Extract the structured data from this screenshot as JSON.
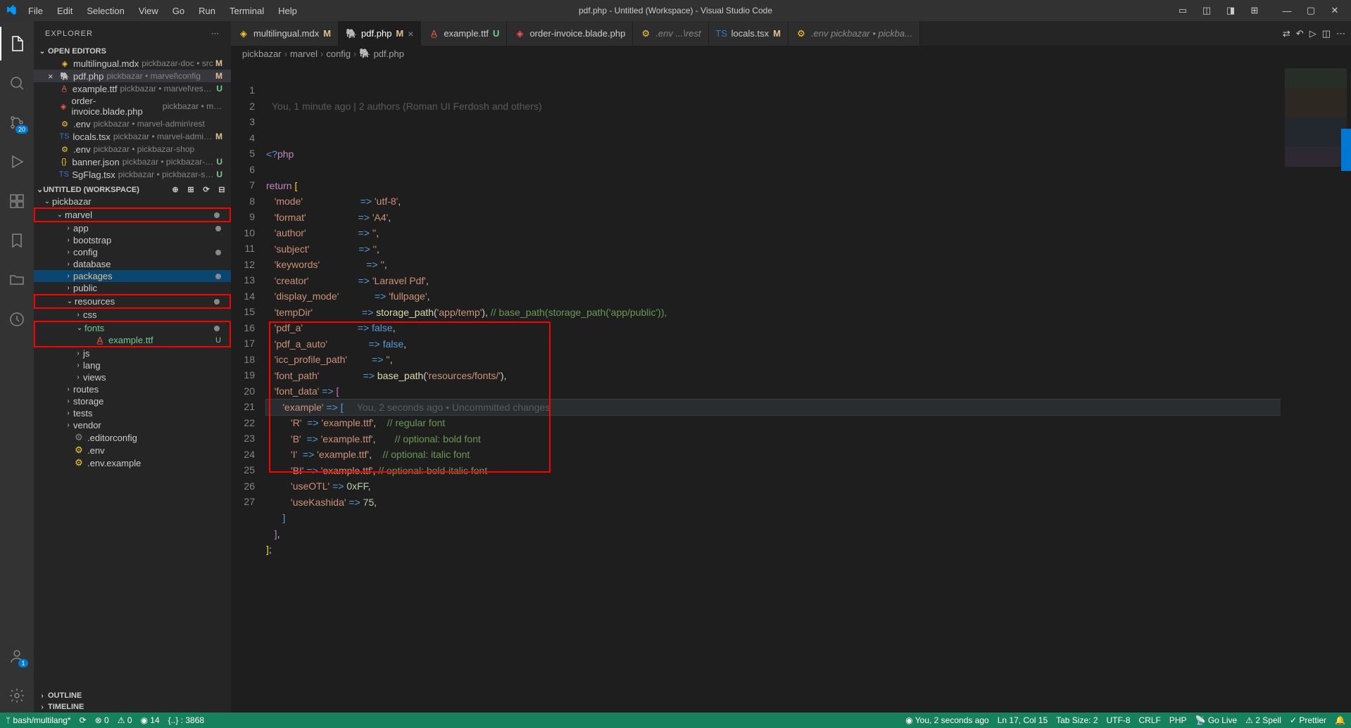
{
  "title": "pdf.php - Untitled (Workspace) - Visual Studio Code",
  "menu": [
    "File",
    "Edit",
    "Selection",
    "View",
    "Go",
    "Run",
    "Terminal",
    "Help"
  ],
  "explorer": {
    "title": "EXPLORER",
    "openEditors": {
      "label": "OPEN EDITORS",
      "items": [
        {
          "icon": "mdx",
          "iconColor": "#ffca28",
          "name": "multilingual.mdx",
          "path": "pickbazar-doc • src",
          "status": "M"
        },
        {
          "icon": "php",
          "iconColor": "#c586c0",
          "name": "pdf.php",
          "path": "pickbazar • marvel\\config",
          "status": "M",
          "active": true
        },
        {
          "icon": "ttf",
          "iconColor": "#e05d44",
          "name": "example.ttf",
          "path": "pickbazar • marvel\\resou...",
          "status": "U"
        },
        {
          "icon": "blade",
          "iconColor": "#ff5252",
          "name": "order-invoice.blade.php",
          "path": "pickbazar • mar...",
          "status": ""
        },
        {
          "icon": "env",
          "iconColor": "#ffca28",
          "name": ".env",
          "path": "pickbazar • marvel-admin\\rest",
          "status": ""
        },
        {
          "icon": "ts",
          "iconColor": "#3178c6",
          "name": "locals.tsx",
          "path": "pickbazar • marvel-admin\\...",
          "status": "M"
        },
        {
          "icon": "env",
          "iconColor": "#ffca28",
          "name": ".env",
          "path": "pickbazar • pickbazar-shop",
          "status": ""
        },
        {
          "icon": "json",
          "iconColor": "#ffca28",
          "name": "banner.json",
          "path": "pickbazar • pickbazar-sh...",
          "status": "U"
        },
        {
          "icon": "tsx",
          "iconColor": "#3178c6",
          "name": "SgFlag.tsx",
          "path": "pickbazar • pickbazar-sho...",
          "status": "U"
        }
      ]
    },
    "workspace": {
      "label": "UNTITLED (WORKSPACE)",
      "tree": [
        {
          "indent": 0,
          "chev": "d",
          "name": "pickbazar",
          "type": "folder"
        },
        {
          "indent": 1,
          "chev": "d",
          "name": "marvel",
          "type": "folder",
          "dot": true,
          "redbox": true
        },
        {
          "indent": 2,
          "chev": "r",
          "name": "app",
          "type": "folder",
          "dot": true
        },
        {
          "indent": 2,
          "chev": "r",
          "name": "bootstrap",
          "type": "folder"
        },
        {
          "indent": 2,
          "chev": "r",
          "name": "config",
          "type": "folder",
          "dot": true
        },
        {
          "indent": 2,
          "chev": "r",
          "name": "database",
          "type": "folder"
        },
        {
          "indent": 2,
          "chev": "r",
          "name": "packages",
          "type": "folder",
          "selected": true,
          "orange": true,
          "dot": true
        },
        {
          "indent": 2,
          "chev": "r",
          "name": "public",
          "type": "folder"
        },
        {
          "indent": 2,
          "chev": "d",
          "name": "resources",
          "type": "folder",
          "dot": true,
          "redbox": true
        },
        {
          "indent": 3,
          "chev": "r",
          "name": "css",
          "type": "folder"
        },
        {
          "indent": 3,
          "chev": "d",
          "name": "fonts",
          "type": "folder",
          "dot": true,
          "green": true,
          "redbox": "top"
        },
        {
          "indent": 4,
          "chev": "",
          "name": "example.ttf",
          "type": "file",
          "icon": "ttf",
          "status": "U",
          "green": true,
          "redbox": "bottom"
        },
        {
          "indent": 3,
          "chev": "r",
          "name": "js",
          "type": "folder"
        },
        {
          "indent": 3,
          "chev": "r",
          "name": "lang",
          "type": "folder"
        },
        {
          "indent": 3,
          "chev": "r",
          "name": "views",
          "type": "folder"
        },
        {
          "indent": 2,
          "chev": "r",
          "name": "routes",
          "type": "folder"
        },
        {
          "indent": 2,
          "chev": "r",
          "name": "storage",
          "type": "folder"
        },
        {
          "indent": 2,
          "chev": "r",
          "name": "tests",
          "type": "folder"
        },
        {
          "indent": 2,
          "chev": "r",
          "name": "vendor",
          "type": "folder"
        },
        {
          "indent": 2,
          "chev": "",
          "name": ".editorconfig",
          "type": "file",
          "icon": "cfg"
        },
        {
          "indent": 2,
          "chev": "",
          "name": ".env",
          "type": "file",
          "icon": "env"
        },
        {
          "indent": 2,
          "chev": "",
          "name": ".env.example",
          "type": "file",
          "icon": "env"
        }
      ]
    },
    "outline": "OUTLINE",
    "timeline": "TIMELINE"
  },
  "tabs": [
    {
      "icon": "mdx",
      "label": "multilingual.mdx",
      "mod": "M"
    },
    {
      "icon": "php",
      "label": "pdf.php",
      "mod": "M",
      "active": true,
      "close": true
    },
    {
      "icon": "ttf",
      "label": "example.ttf",
      "mod": "U"
    },
    {
      "icon": "blade",
      "label": "order-invoice.blade.php",
      "mod": ""
    },
    {
      "icon": "env",
      "label": ".env ...\\rest",
      "mod": "",
      "env": true
    },
    {
      "icon": "ts",
      "label": "locals.tsx",
      "mod": "M"
    },
    {
      "icon": "env",
      "label": ".env pickbazar • pickba...",
      "mod": "",
      "env": true
    }
  ],
  "breadcrumb": [
    "pickbazar",
    "marvel",
    "config",
    "pdf.php"
  ],
  "blame": "You, 1 minute ago | 2 authors (Roman UI Ferdosh and others)",
  "inlineBlame": "You, 2 seconds ago • Uncommitted changes",
  "code": {
    "lines": [
      {
        "n": 1,
        "html": "<span class='op'>&lt;?</span><span class='k'>php</span>"
      },
      {
        "n": 2,
        "html": ""
      },
      {
        "n": 3,
        "html": "<span class='k'>return</span> <span class='br'>[</span>"
      },
      {
        "n": 4,
        "html": "   <span class='s'>'mode'</span>                     <span class='op'>=&gt;</span> <span class='s'>'utf-8'</span>,"
      },
      {
        "n": 5,
        "html": "   <span class='s'>'format'</span>                   <span class='op'>=&gt;</span> <span class='s'>'A4'</span>,"
      },
      {
        "n": 6,
        "html": "   <span class='s'>'author'</span>                   <span class='op'>=&gt;</span> <span class='s'>''</span>,"
      },
      {
        "n": 7,
        "html": "   <span class='s'>'subject'</span>                  <span class='op'>=&gt;</span> <span class='s'>''</span>,"
      },
      {
        "n": 8,
        "html": "   <span class='s'>'keywords'</span>                 <span class='op'>=&gt;</span> <span class='s'>''</span>,"
      },
      {
        "n": 9,
        "html": "   <span class='s'>'creator'</span>                  <span class='op'>=&gt;</span> <span class='s'>'Laravel Pdf'</span>,"
      },
      {
        "n": 10,
        "html": "   <span class='s'>'display_mode'</span>             <span class='op'>=&gt;</span> <span class='s'>'fullpage'</span>,"
      },
      {
        "n": 11,
        "html": "   <span class='s'>'tempDir'</span>                  <span class='op'>=&gt;</span> <span class='fn'>storage_path</span>(<span class='s'>'app/temp'</span>), <span class='cm'>// base_path(storage_path('app/public')),</span>"
      },
      {
        "n": 12,
        "html": "   <span class='s'>'pdf_a'</span>                    <span class='op'>=&gt;</span> <span class='op'>false</span>,"
      },
      {
        "n": 13,
        "html": "   <span class='s'>'pdf_a_auto'</span>               <span class='op'>=&gt;</span> <span class='op'>false</span>,"
      },
      {
        "n": 14,
        "html": "   <span class='s'>'icc_profile_path'</span>         <span class='op'>=&gt;</span> <span class='s'>''</span>,"
      },
      {
        "n": 15,
        "html": "   <span class='s'>'font_path'</span>                <span class='op'>=&gt;</span> <span class='fn'>base_path</span>(<span class='s'>'resources/fonts/'</span>),"
      },
      {
        "n": 16,
        "html": "   <span class='s'>'font_data'</span> <span class='op'>=&gt;</span> <span class='br2'>[</span>"
      },
      {
        "n": 17,
        "html": "      <span class='s'>'example'</span> <span class='op'>=&gt;</span> <span class='br3'>[</span>     <span class='dim'>You, 2 seconds ago • Uncommitted changes</span>",
        "hl": true
      },
      {
        "n": 18,
        "html": "         <span class='s'>'R'</span>  <span class='op'>=&gt;</span> <span class='s'>'example.ttf'</span>,    <span class='cm'>// regular font</span>"
      },
      {
        "n": 19,
        "html": "         <span class='s'>'B'</span>  <span class='op'>=&gt;</span> <span class='s'>'example.ttf'</span>,       <span class='cm'>// optional: bold font</span>"
      },
      {
        "n": 20,
        "html": "         <span class='s'>'I'</span>  <span class='op'>=&gt;</span> <span class='s'>'example.ttf'</span>,    <span class='cm'>// optional: italic font</span>"
      },
      {
        "n": 21,
        "html": "         <span class='s'>'BI'</span> <span class='op'>=&gt;</span> <span class='s'>'example.ttf'</span>, <span class='cm'>// optional: bold-italic font</span>"
      },
      {
        "n": 22,
        "html": "         <span class='s'>'useOTL'</span> <span class='op'>=&gt;</span> <span class='nm'>0xFF</span>,"
      },
      {
        "n": 23,
        "html": "         <span class='s'>'useKashida'</span> <span class='op'>=&gt;</span> <span class='nm'>75</span>,"
      },
      {
        "n": 24,
        "html": "      <span class='br3'>]</span>"
      },
      {
        "n": 25,
        "html": "   <span class='br2'>]</span>,"
      },
      {
        "n": 26,
        "html": "<span class='br'>]</span>;"
      },
      {
        "n": 27,
        "html": ""
      }
    ]
  },
  "status": {
    "left": {
      "branch": "bash/multilang*",
      "sync": "⟳",
      "err": "⊗ 0",
      "warn": "⚠ 0",
      "info": "◉ 14",
      "sel": "{..} : 3868"
    },
    "right": {
      "blame": "You, 2 seconds ago",
      "pos": "Ln 17, Col 15",
      "tab": "Tab Size: 2",
      "enc": "UTF-8",
      "eol": "CRLF",
      "lang": "PHP",
      "golive": "Go Live",
      "spell": "2 Spell",
      "fmt": "Prettier",
      "bell": "🔔"
    }
  },
  "activityBadges": {
    "scm": "20",
    "account": "1"
  }
}
